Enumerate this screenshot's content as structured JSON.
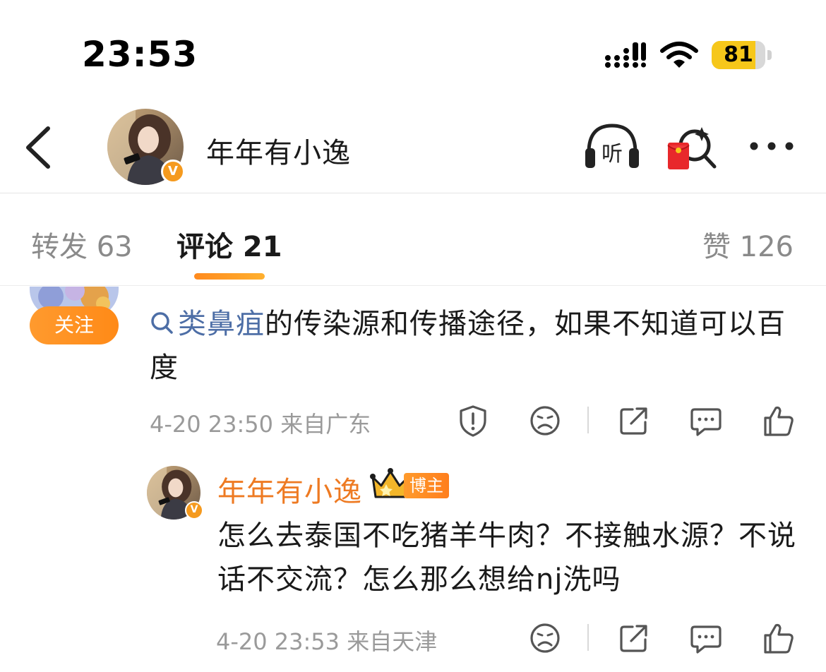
{
  "status_bar": {
    "time": "23:53",
    "battery_level": "81",
    "battery_fraction": 0.81,
    "signal_icon": "signal-icon",
    "wifi_icon": "wifi-icon"
  },
  "header": {
    "back_icon": "chevron-left-icon",
    "user_name": "年年有小逸",
    "verified_badge": "V",
    "listen_icon_label": "听",
    "icons": [
      "listen-icon",
      "red-packet-search-icon",
      "more-icon"
    ]
  },
  "tabs": {
    "repost": "转发 63",
    "comment": "评论 21",
    "like": "赞 126"
  },
  "comments": [
    {
      "follow_label": "关注",
      "search_term": "类鼻疽",
      "text_after": "的传染源和传播途径，如果不知道可以百度",
      "time": "4-20 23:50",
      "location": "来自广东",
      "actions": [
        "report-icon",
        "dislike-face-icon",
        "share-icon",
        "reply-icon",
        "like-icon"
      ]
    }
  ],
  "reply": {
    "user_name": "年年有小逸",
    "crown_icon": "crown-icon",
    "author_badge": "博主",
    "text": "怎么去泰国不吃猪羊牛肉？不接触水源？不说话不交流？怎么那么想给nj洗吗",
    "time": "4-20 23:53",
    "location": "来自天津",
    "actions": [
      "dislike-face-icon",
      "share-icon",
      "reply-icon",
      "like-icon"
    ]
  },
  "colors": {
    "accent_orange": "#ff8a1e",
    "link_blue": "#4d6ea6",
    "name_orange": "#ee7a22",
    "battery_yellow": "#f6c71a",
    "muted_gray": "#9a9a9a"
  }
}
